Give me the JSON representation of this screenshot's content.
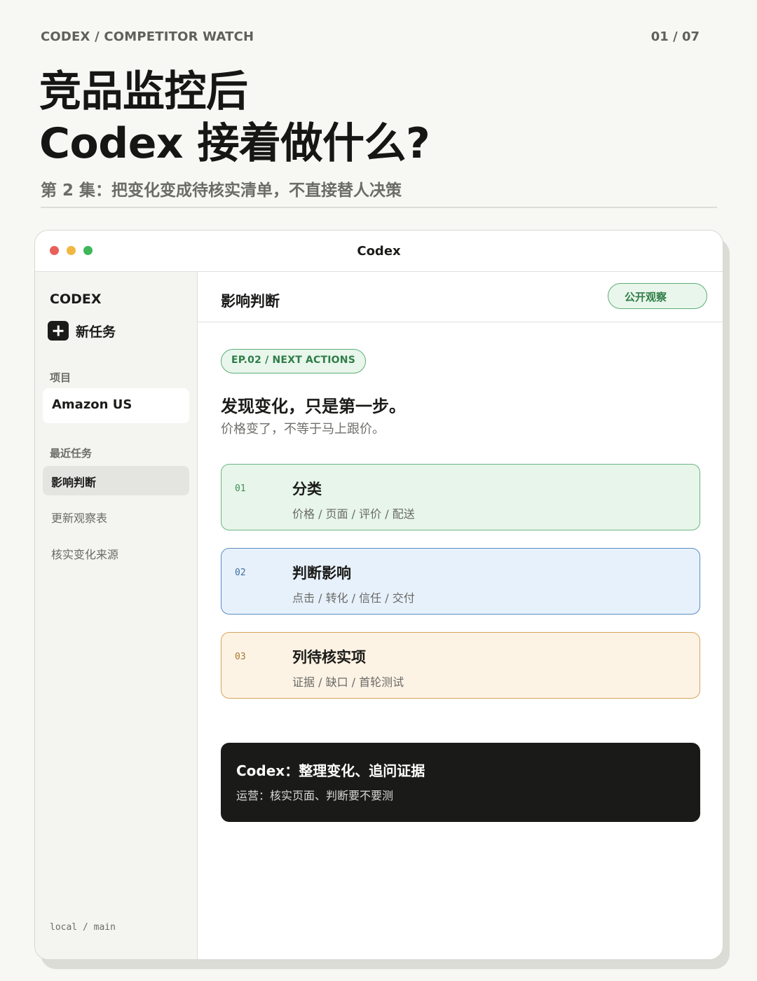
{
  "poster": {
    "kicker": "CODEX / COMPETITOR WATCH",
    "page_count": "01 / 07",
    "headline_line1": "竞品监控后",
    "headline_line2": "Codex 接着做什么?",
    "subheadline": "第 2 集：把变化变成待核实清单，不直接替人决策"
  },
  "window": {
    "title": "Codex"
  },
  "sidebar": {
    "brand": "CODEX",
    "new_task": "新任务",
    "projects_label": "项目",
    "project": "Amazon US",
    "recent_label": "最近任务",
    "recent_items": [
      {
        "label": "影响判断",
        "active": true
      },
      {
        "label": "更新观察表",
        "active": false
      },
      {
        "label": "核实变化来源",
        "active": false
      }
    ],
    "branch": "local / main"
  },
  "main": {
    "title": "影响判断",
    "visibility_pill": "公开观察",
    "episode_badge": "EP.02 / NEXT ACTIONS",
    "lead_title": "发现变化，只是第一步。",
    "lead_sub": "价格变了，不等于马上跟价。",
    "steps": [
      {
        "num": "01",
        "title": "分类",
        "tags": "价格 / 页面 / 评价 / 配送",
        "accent": "#6ab782"
      },
      {
        "num": "02",
        "title": "判断影响",
        "tags": "点击 / 转化 / 信任 / 交付",
        "accent": "#5c8cc4"
      },
      {
        "num": "03",
        "title": "列待核实项",
        "tags": "证据 / 缺口 / 首轮测试",
        "accent": "#d7a45a"
      }
    ],
    "summary": {
      "title": "Codex：整理变化、追问证据",
      "sub": "运营：核实页面、判断要不要测"
    }
  },
  "colors": {
    "background": "#f7f7f4",
    "ink": "#1b1b19",
    "green": "#2f7d48",
    "blue": "#3f6e9f",
    "amber": "#a8782f"
  }
}
